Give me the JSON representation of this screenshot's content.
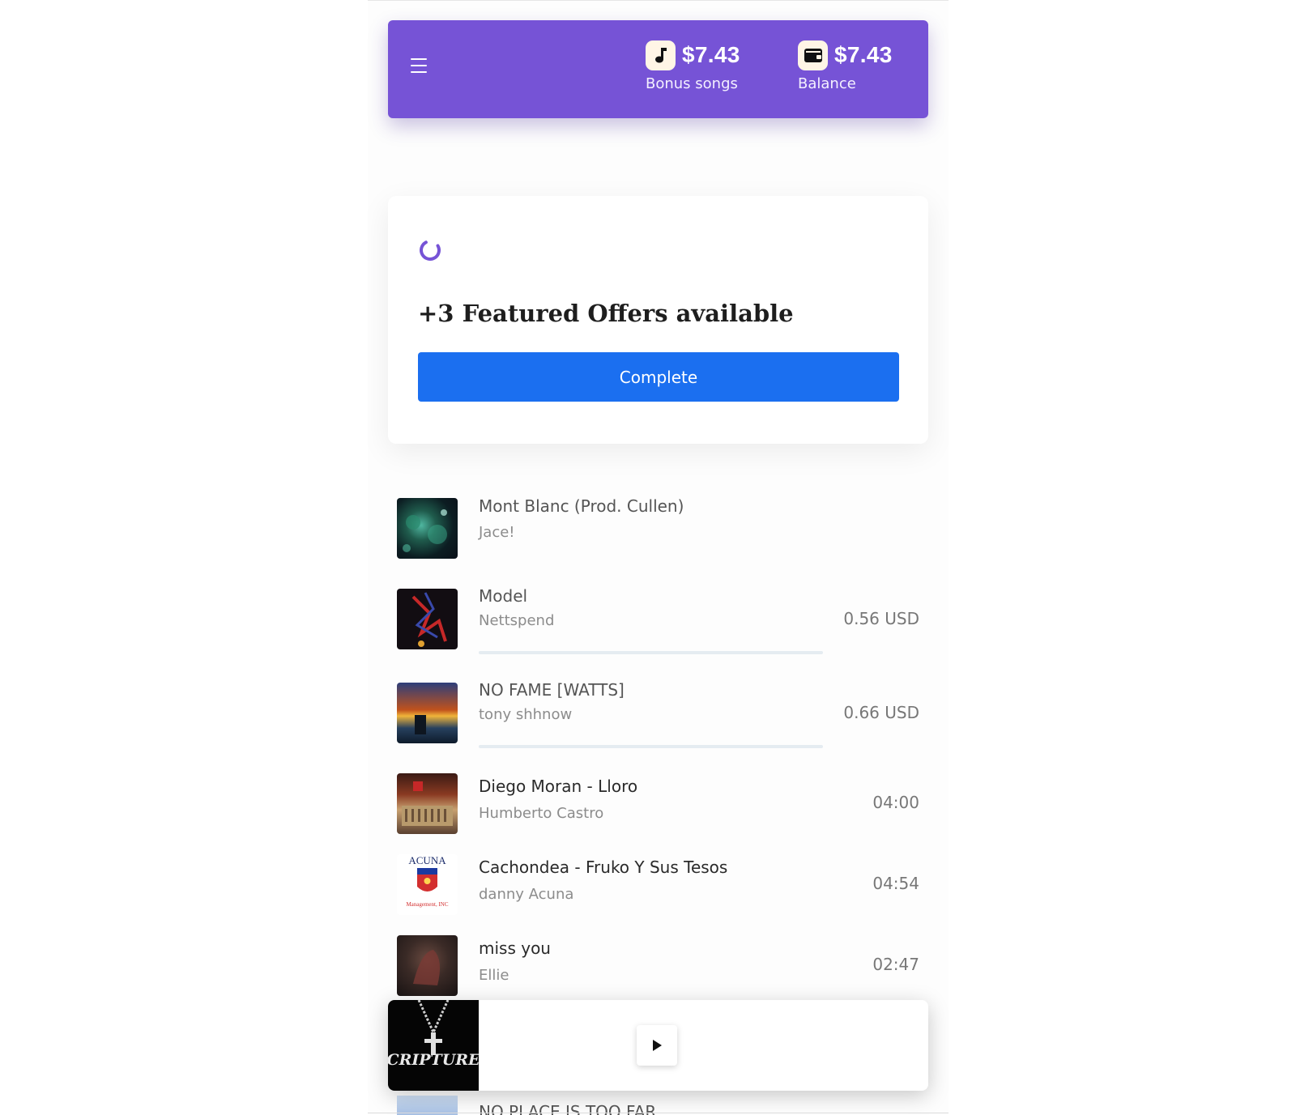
{
  "header": {
    "bonus": {
      "amount": "$7.43",
      "label": "Bonus songs",
      "icon": "music-note-icon"
    },
    "balance": {
      "amount": "$7.43",
      "label": "Balance",
      "icon": "wallet-icon"
    },
    "menu_icon": "hamburger-menu-icon",
    "color": "#7653d6"
  },
  "offers": {
    "title": "+3 Featured Offers available",
    "button_label": "Complete",
    "button_color": "#1b6ff0",
    "spinner_color": "#7653d6"
  },
  "songs": [
    {
      "title": "Mont Blanc (Prod. Cullen)",
      "artist": "Jace!",
      "meta": ""
    },
    {
      "title": "Model",
      "artist": "Nettspend",
      "meta": "0.56 USD"
    },
    {
      "title": "NO FAME [WATTS]",
      "artist": "tony shhnow",
      "meta": "0.66 USD"
    },
    {
      "title": "Diego Moran - Lloro",
      "artist": "Humberto Castro",
      "meta": "04:00"
    },
    {
      "title": "Cachondea - Fruko Y Sus Tesos",
      "artist": "danny Acuna",
      "meta": "04:54"
    },
    {
      "title": "miss you",
      "artist": "Ellie",
      "meta": "02:47"
    },
    {
      "title": "NO PLACE IS TOO FAR",
      "artist": "",
      "meta": ""
    }
  ],
  "acuna_logo": {
    "top": "ACUNA",
    "bottom": "Management, INC"
  },
  "player": {
    "art_text": "SCRIPTURES",
    "play_icon": "play-icon"
  }
}
